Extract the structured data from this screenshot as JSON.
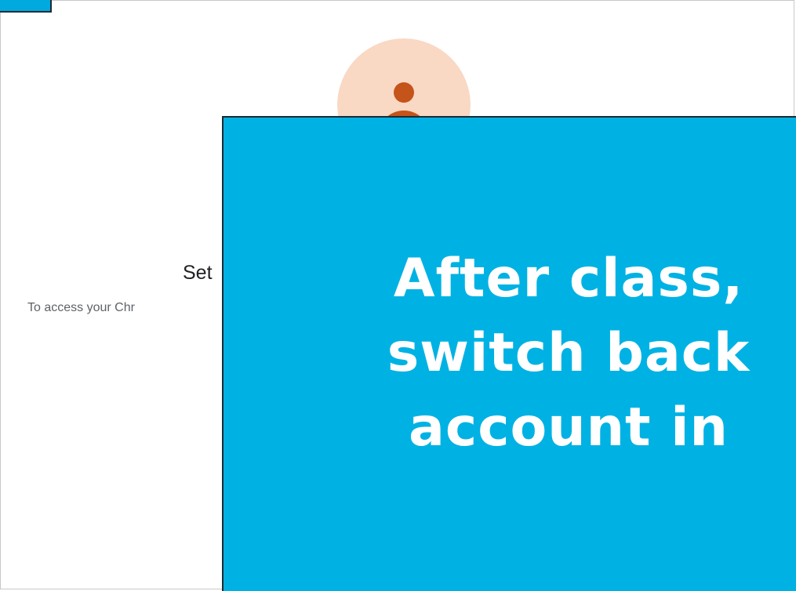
{
  "dialog": {
    "title": "Set",
    "subtitle": "To access your Chr"
  },
  "overlay": {
    "lines": [
      "After class,",
      "switch back",
      "account in"
    ]
  },
  "colors": {
    "overlay_bg": "#00b2e3",
    "avatar_bg": "#f9d8c4",
    "avatar_fg": "#c4541a"
  },
  "icons": {
    "avatar": "person-icon"
  }
}
